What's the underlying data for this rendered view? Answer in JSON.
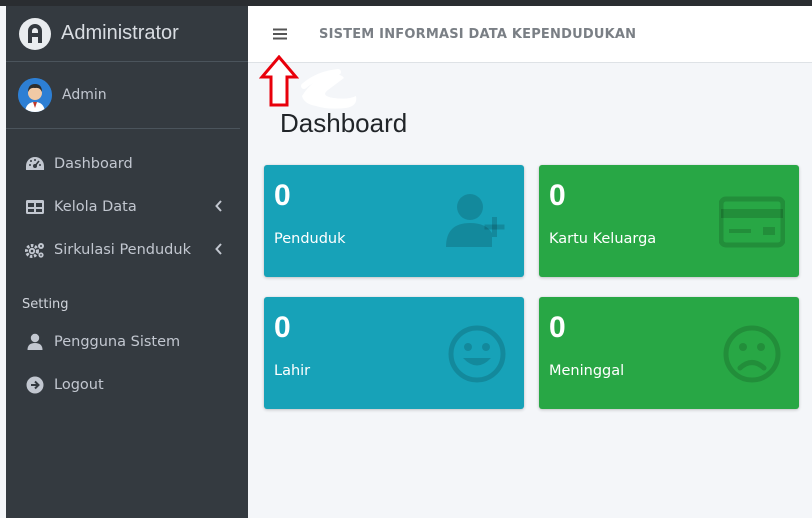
{
  "brand": {
    "title": "Administrator",
    "logo_icon": "brand-logo-icon"
  },
  "user": {
    "name": "Admin",
    "avatar_icon": "user-avatar-icon"
  },
  "sidebar": {
    "items": [
      {
        "label": "Dashboard",
        "icon": "tachometer-icon"
      },
      {
        "label": "Kelola Data",
        "icon": "table-icon",
        "has_submenu": true
      },
      {
        "label": "Sirkulasi Penduduk",
        "icon": "cogs-icon",
        "has_submenu": true
      }
    ],
    "section_header": "Setting",
    "setting_items": [
      {
        "label": "Pengguna Sistem",
        "icon": "user-icon"
      },
      {
        "label": "Logout",
        "icon": "sign-out-icon"
      }
    ]
  },
  "header": {
    "title": "SISTEM INFORMASI DATA KEPENDUDUKAN",
    "menu_icon": "hamburger-icon"
  },
  "page": {
    "title": "Dashboard"
  },
  "cards": [
    {
      "value": "0",
      "label": "Penduduk",
      "icon": "user-plus-icon",
      "color": "#17a2b8"
    },
    {
      "value": "0",
      "label": "Kartu Keluarga",
      "icon": "credit-card-icon",
      "color": "#28a745"
    },
    {
      "value": "0",
      "label": "Lahir",
      "icon": "smile-icon",
      "color": "#17a2b8"
    },
    {
      "value": "0",
      "label": "Meninggal",
      "icon": "frown-icon",
      "color": "#28a745"
    }
  ],
  "colors": {
    "sidebar": "#343a40",
    "info": "#17a2b8",
    "success": "#28a745",
    "annotation": "#e8000b"
  }
}
